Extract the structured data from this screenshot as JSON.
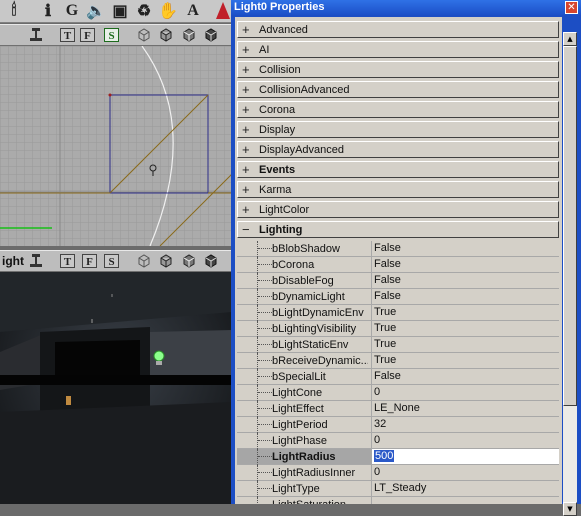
{
  "toolbar": {
    "items": [
      {
        "name": "actor-tool-icon",
        "glyph": "🕯"
      },
      {
        "name": "info-icon",
        "glyph": "ℹ"
      },
      {
        "name": "group-tool-button",
        "glyph": "G"
      },
      {
        "name": "sound-tool-icon",
        "glyph": "🔈"
      },
      {
        "name": "texture-browser-icon",
        "glyph": "▣"
      },
      {
        "name": "mesh-browser-icon",
        "glyph": "♻"
      },
      {
        "name": "animation-browser-icon",
        "glyph": "✋"
      },
      {
        "name": "font-browser-button",
        "glyph": "A"
      }
    ]
  },
  "viewports": {
    "top": {
      "title": "",
      "buttons": [
        "T",
        "F",
        "S"
      ],
      "selected": "S"
    },
    "perspective": {
      "title": "ight",
      "buttons": [
        "T",
        "F",
        "S"
      ]
    }
  },
  "properties": {
    "window_title": "Light0 Properties",
    "close_label": "✕",
    "categories": [
      {
        "label": "Advanced",
        "sign": "+",
        "bold": false
      },
      {
        "label": "AI",
        "sign": "+",
        "bold": false
      },
      {
        "label": "Collision",
        "sign": "+",
        "bold": false
      },
      {
        "label": "CollisionAdvanced",
        "sign": "+",
        "bold": false
      },
      {
        "label": "Corona",
        "sign": "+",
        "bold": false
      },
      {
        "label": "Display",
        "sign": "+",
        "bold": false
      },
      {
        "label": "DisplayAdvanced",
        "sign": "+",
        "bold": false
      },
      {
        "label": "Events",
        "sign": "+",
        "bold": true
      },
      {
        "label": "Karma",
        "sign": "+",
        "bold": false
      },
      {
        "label": "LightColor",
        "sign": "+",
        "bold": false
      },
      {
        "label": "Lighting",
        "sign": "−",
        "bold": true
      }
    ],
    "lighting_props": [
      {
        "name": "bBlobShadow",
        "value": "False"
      },
      {
        "name": "bCorona",
        "value": "False"
      },
      {
        "name": "bDisableFog",
        "value": "False"
      },
      {
        "name": "bDynamicLight",
        "value": "False"
      },
      {
        "name": "bLightDynamicEnv",
        "value": "True"
      },
      {
        "name": "bLightingVisibility",
        "value": "True"
      },
      {
        "name": "bLightStaticEnv",
        "value": "True"
      },
      {
        "name": "bReceiveDynamic...",
        "value": "True"
      },
      {
        "name": "bSpecialLit",
        "value": "False"
      },
      {
        "name": "LightCone",
        "value": "0"
      },
      {
        "name": "LightEffect",
        "value": "LE_None"
      },
      {
        "name": "LightPeriod",
        "value": "32"
      },
      {
        "name": "LightPhase",
        "value": "0"
      },
      {
        "name": "LightRadius",
        "value": "500",
        "selected": true
      },
      {
        "name": "LightRadiusInner",
        "value": "0"
      },
      {
        "name": "LightType",
        "value": "LT_Steady"
      },
      {
        "name": "LightSaturation",
        "value": ""
      }
    ]
  },
  "colors": {
    "titlebar": "#1c50c8",
    "grid_bg": "#a9a9a9",
    "selection": "#2b59c8"
  }
}
